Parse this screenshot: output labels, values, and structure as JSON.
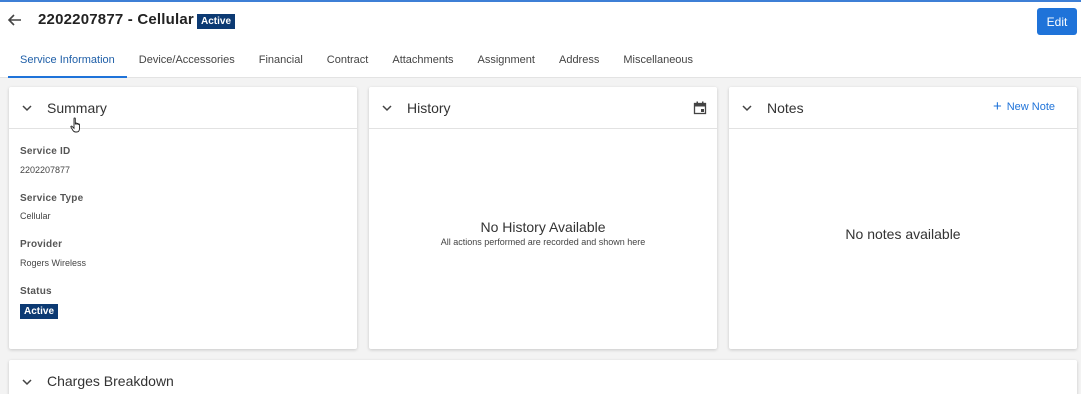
{
  "header": {
    "title": "2202207877 - Cellular",
    "status_badge": "Active",
    "edit_label": "Edit"
  },
  "tabs": [
    {
      "label": "Service Information",
      "active": true
    },
    {
      "label": "Device/Accessories"
    },
    {
      "label": "Financial"
    },
    {
      "label": "Contract"
    },
    {
      "label": "Attachments"
    },
    {
      "label": "Assignment"
    },
    {
      "label": "Address"
    },
    {
      "label": "Miscellaneous"
    }
  ],
  "summary": {
    "title": "Summary",
    "fields": [
      {
        "label": "Service ID",
        "value": "2202207877"
      },
      {
        "label": "Service Type",
        "value": "Cellular"
      },
      {
        "label": "Provider",
        "value": "Rogers Wireless"
      },
      {
        "label": "Status",
        "value": "Active"
      }
    ]
  },
  "history": {
    "title": "History",
    "empty_title": "No History Available",
    "empty_subtitle": "All actions performed are recorded and shown here"
  },
  "notes": {
    "title": "Notes",
    "new_note_label": "New Note",
    "empty_title": "No notes available"
  },
  "charges": {
    "title": "Charges Breakdown"
  },
  "colors": {
    "accent": "#1f73d9",
    "badge": "#0c3a73"
  }
}
